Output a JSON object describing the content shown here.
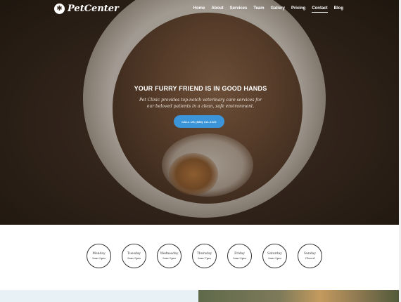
{
  "brand": {
    "name": "PetCenter",
    "logo_icon": "paw-icon"
  },
  "nav": {
    "items": [
      {
        "label": "Home",
        "active": false
      },
      {
        "label": "About",
        "active": false
      },
      {
        "label": "Services",
        "active": false
      },
      {
        "label": "Team",
        "active": false
      },
      {
        "label": "Gallery",
        "active": false
      },
      {
        "label": "Pricing",
        "active": false
      },
      {
        "label": "Contact",
        "active": true
      },
      {
        "label": "Blog",
        "active": false
      }
    ]
  },
  "hero": {
    "title": "YOUR FURRY FRIEND IS IN GOOD HANDS",
    "subtitle": "Pet Clinic provides top-notch veterinary care services for our beloved patients in a clean, safe environment.",
    "cta_label": "CALL US (888) 111-2222"
  },
  "hours": [
    {
      "day": "Monday",
      "time": "9am-5pm"
    },
    {
      "day": "Tuesday",
      "time": "9am-5pm"
    },
    {
      "day": "Wednesday",
      "time": "9am-5pm"
    },
    {
      "day": "Thursday",
      "time": "9am-7pm"
    },
    {
      "day": "Friday",
      "time": "9am-5pm"
    },
    {
      "day": "Saturday",
      "time": "9am-5pm"
    },
    {
      "day": "Sunday",
      "time": "Closed"
    }
  ],
  "colors": {
    "accent": "#3b95d8",
    "text_dark": "#333333"
  }
}
